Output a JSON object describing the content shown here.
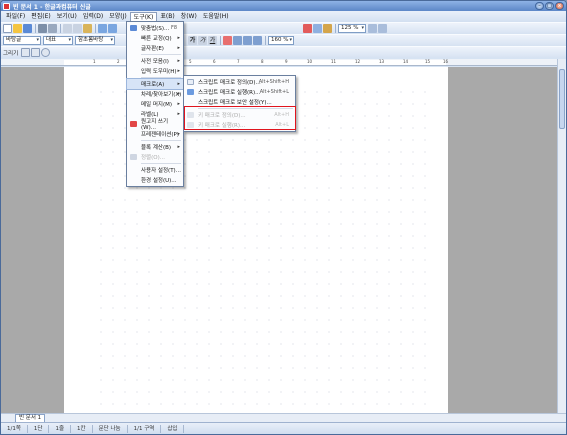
{
  "window": {
    "title": "빈 문서 1 - 한글과컴퓨터 신글"
  },
  "menubar": [
    {
      "label": "파일(F)"
    },
    {
      "label": "편집(E)"
    },
    {
      "label": "보기(U)"
    },
    {
      "label": "입력(D)"
    },
    {
      "label": "모양(J)"
    },
    {
      "label": "도구(K)"
    },
    {
      "label": "표(B)"
    },
    {
      "label": "창(W)"
    },
    {
      "label": "도움말(H)"
    }
  ],
  "toolbar2": {
    "font_name": "바탕글",
    "font_lang": "대표",
    "font_face": "함초롬바탕",
    "zoom": "125 %"
  },
  "toolbar3": {
    "spacing": "160 %",
    "draw_label": "그리기"
  },
  "tools_menu": {
    "items": [
      {
        "label": "맞춤법(S)...",
        "shortcut": "F8"
      },
      {
        "label": "빠른 교정(Q)",
        "arrow": "▸"
      },
      {
        "label": "글자판(E)",
        "arrow": "▸"
      },
      {
        "label": "사전 모음(I)",
        "arrow": "▸"
      },
      {
        "label": "입력 도우미(H)",
        "arrow": "▸"
      },
      {
        "label": "매크로(A)",
        "arrow": "▸"
      },
      {
        "label": "차례/찾아보기(X)",
        "arrow": "▸"
      },
      {
        "label": "메일 머지(M)",
        "arrow": "▸"
      },
      {
        "label": "라벨(L)",
        "arrow": "▸"
      },
      {
        "label": "원고지 쓰기(W)..."
      },
      {
        "label": "프레젠테이션(P)",
        "arrow": "▸"
      },
      {
        "label": "블록 계산(B)",
        "arrow": "▸"
      },
      {
        "label": "정렬(O)..."
      },
      {
        "label": "사용자 설정(T)..."
      },
      {
        "label": "환경 설정(U)..."
      }
    ]
  },
  "macro_submenu": {
    "items": [
      {
        "label": "스크립트 매크로 정의(D)...",
        "shortcut": "Alt+Shift+H"
      },
      {
        "label": "스크립트 매크로 실행(R)...",
        "shortcut": "Alt+Shift+L"
      },
      {
        "label": "스크립트 매크로 보안 설정(Y)..."
      },
      {
        "label": "키 매크로 정의(D)...",
        "shortcut": "Alt+H"
      },
      {
        "label": "키 매크로 실행(R)...",
        "shortcut": "Alt+L"
      }
    ]
  },
  "ruler_numbers": [
    "1",
    "2",
    "3",
    "4",
    "5",
    "6",
    "7",
    "8",
    "9",
    "10",
    "11",
    "12",
    "13",
    "14",
    "15",
    "16"
  ],
  "doc_tab": "빈 문서 1",
  "status": [
    "1/1쪽",
    "1단",
    "1줄",
    "1칸",
    "문단 나눔",
    "1/1 구역",
    "삽입"
  ],
  "colors": {
    "accent": "#e0141e",
    "titlebar": "#5d87c7"
  }
}
